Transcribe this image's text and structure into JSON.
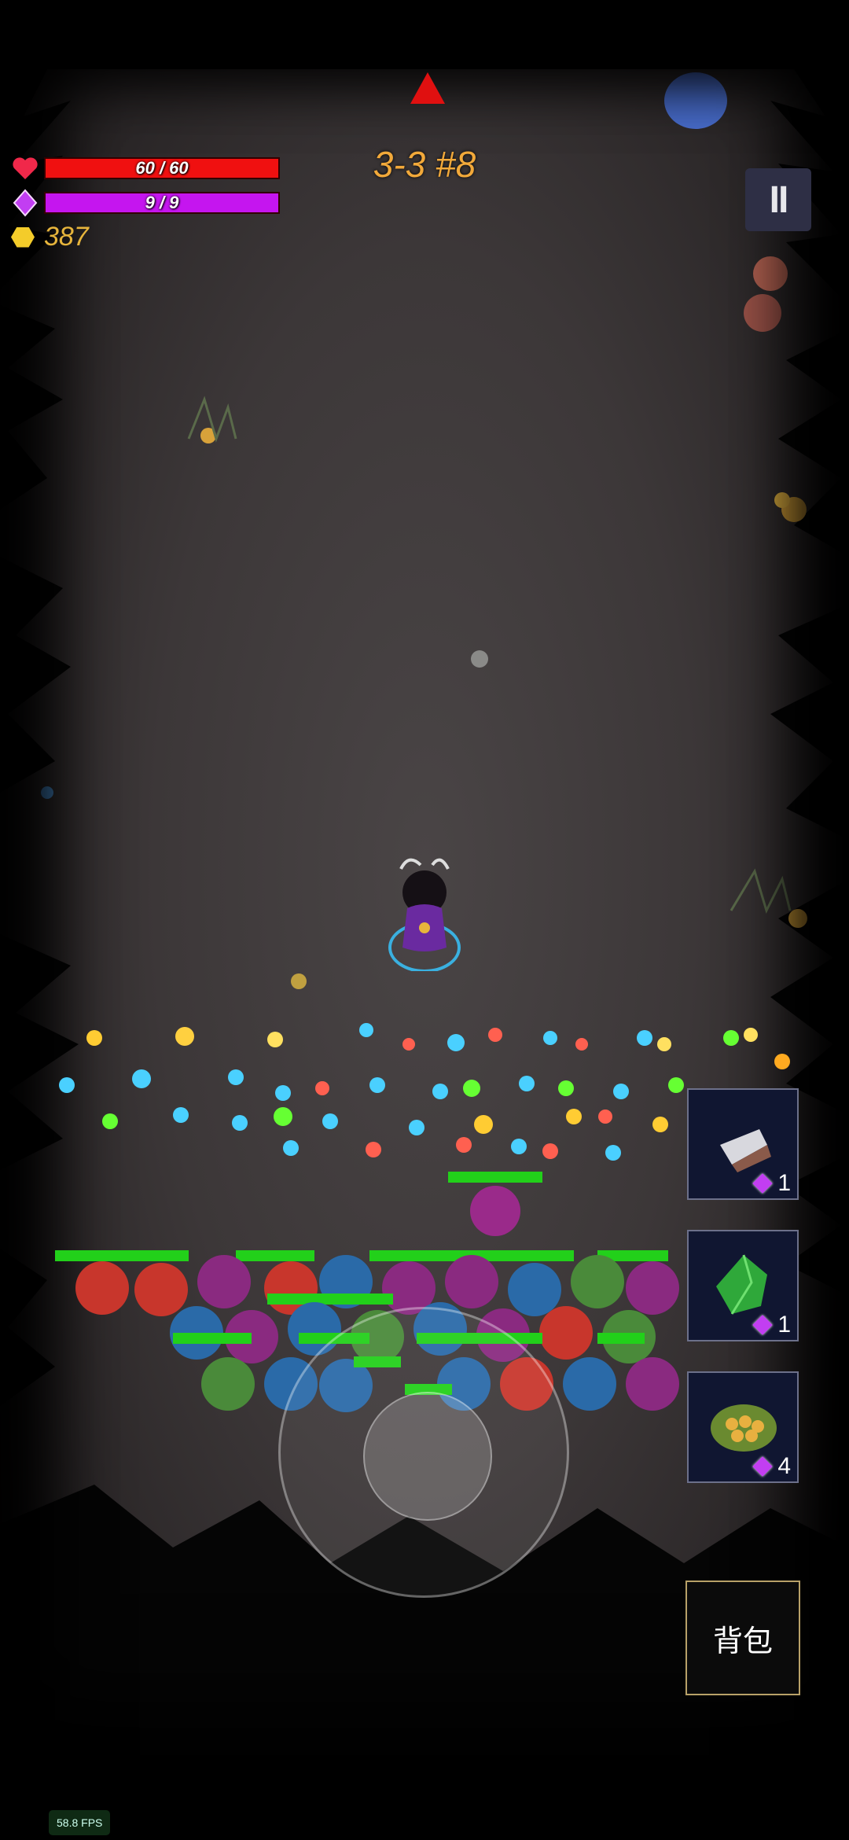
{
  "hud": {
    "hp_text": "60 / 60",
    "hp_fill": 1.0,
    "mp_text": "9 / 9",
    "mp_fill": 1.0,
    "gold": "387",
    "stage": "3-3 #8",
    "pause_label": "II"
  },
  "skills": [
    {
      "name": "paper-scroll",
      "cost": "1"
    },
    {
      "name": "green-crystal",
      "cost": "1"
    },
    {
      "name": "seed-pod",
      "cost": "4"
    }
  ],
  "bag_label": "背包",
  "fps": "58.8 FPS",
  "colors": {
    "hp": "#f01010",
    "mp": "#c515ef",
    "gold": "#e7b53c",
    "stage": "#f2a93a",
    "enemy_hp": "#22d01a"
  },
  "icons": {
    "hp": "heart-icon",
    "mp": "gem-icon",
    "gold": "coin-icon",
    "objective": "up-arrow-icon"
  }
}
